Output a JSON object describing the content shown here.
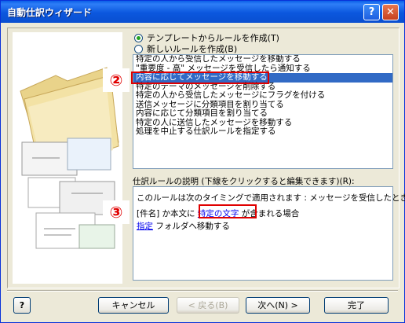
{
  "window": {
    "title": "自動仕訳ウィザード",
    "help_glyph": "?",
    "close_glyph": "✕"
  },
  "options": [
    {
      "label": "テンプレートからルールを作成(T)",
      "selected": true
    },
    {
      "label": "新しいルールを作成(B)",
      "selected": false
    }
  ],
  "templates": [
    "特定の人から受信したメッセージを移動する",
    "\"重要度 - 高\" メッセージを受信したら通知する",
    "内容に応じてメッセージを移動する",
    "特定のテーマのメッセージを削除する",
    "特定の人から受信したメッセージにフラグを付ける",
    "送信メッセージに分類項目を割り当てる",
    "内容に応じて分類項目を割り当てる",
    "特定の人に送信したメッセージを移動する",
    "処理を中止する仕訳ルールを指定する"
  ],
  "selected_template_index": 2,
  "description": {
    "label": "仕訳ルールの説明 (下線をクリックすると編集できます)(R):",
    "line1": "このルールは次のタイミングで適用されます : メッセージを受信したとき",
    "line2_prefix": "[件名] か本文に",
    "line2_link": "特定の文字",
    "line2_suffix": "が含まれる場合",
    "line3_link": "指定",
    "line3_suffix": "フォルダへ移動する"
  },
  "markers": {
    "m2": "②",
    "m3": "③"
  },
  "buttons": {
    "help": "?",
    "cancel": "キャンセル",
    "back": "< 戻る(B)",
    "next": "次へ(N) >",
    "finish": "完了"
  },
  "colors": {
    "selection": "#316AC5",
    "annotation": "#E00000",
    "link": "#0000EE"
  }
}
